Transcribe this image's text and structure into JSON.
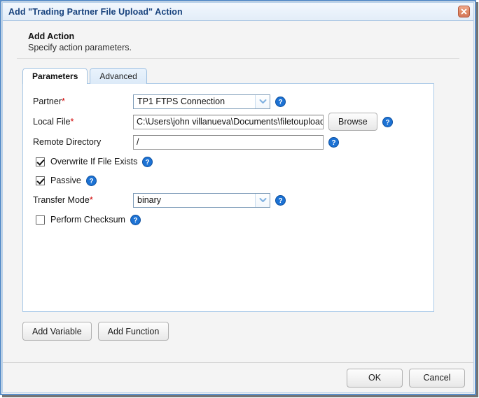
{
  "window": {
    "title": "Add \"Trading Partner File Upload\" Action",
    "close_icon": "close-icon"
  },
  "header": {
    "title": "Add Action",
    "subtitle": "Specify action parameters."
  },
  "tabs": [
    {
      "label": "Parameters",
      "active": true
    },
    {
      "label": "Advanced",
      "active": false
    }
  ],
  "form": {
    "partner": {
      "label": "Partner",
      "required": "*",
      "value": "TP1 FTPS Connection",
      "help_icon": "help-icon",
      "arrow_icon": "chevron-down-icon"
    },
    "local_file": {
      "label": "Local File",
      "required": "*",
      "value": "C:\\Users\\john villanueva\\Documents\\filetoupload",
      "browse_label": "Browse",
      "help_icon": "help-icon"
    },
    "remote_directory": {
      "label": "Remote Directory",
      "value": "/",
      "help_icon": "help-icon"
    },
    "overwrite": {
      "label": "Overwrite If File Exists",
      "checked": true,
      "help_icon": "help-icon"
    },
    "passive": {
      "label": "Passive",
      "checked": true,
      "help_icon": "help-icon"
    },
    "transfer_mode": {
      "label": "Transfer Mode",
      "required": "*",
      "value": "binary",
      "help_icon": "help-icon",
      "arrow_icon": "chevron-down-icon"
    },
    "perform_checksum": {
      "label": "Perform Checksum",
      "checked": false,
      "help_icon": "help-icon"
    }
  },
  "lower_buttons": {
    "add_variable": "Add Variable",
    "add_function": "Add Function"
  },
  "footer": {
    "ok": "OK",
    "cancel": "Cancel"
  },
  "colors": {
    "title_text": "#16417c",
    "frame_border": "#5b8fc9",
    "panel_border": "#a9c9e8",
    "required_marker": "#d00000",
    "help_blue": "#1c72d4",
    "close_orange": "#e08a66"
  }
}
